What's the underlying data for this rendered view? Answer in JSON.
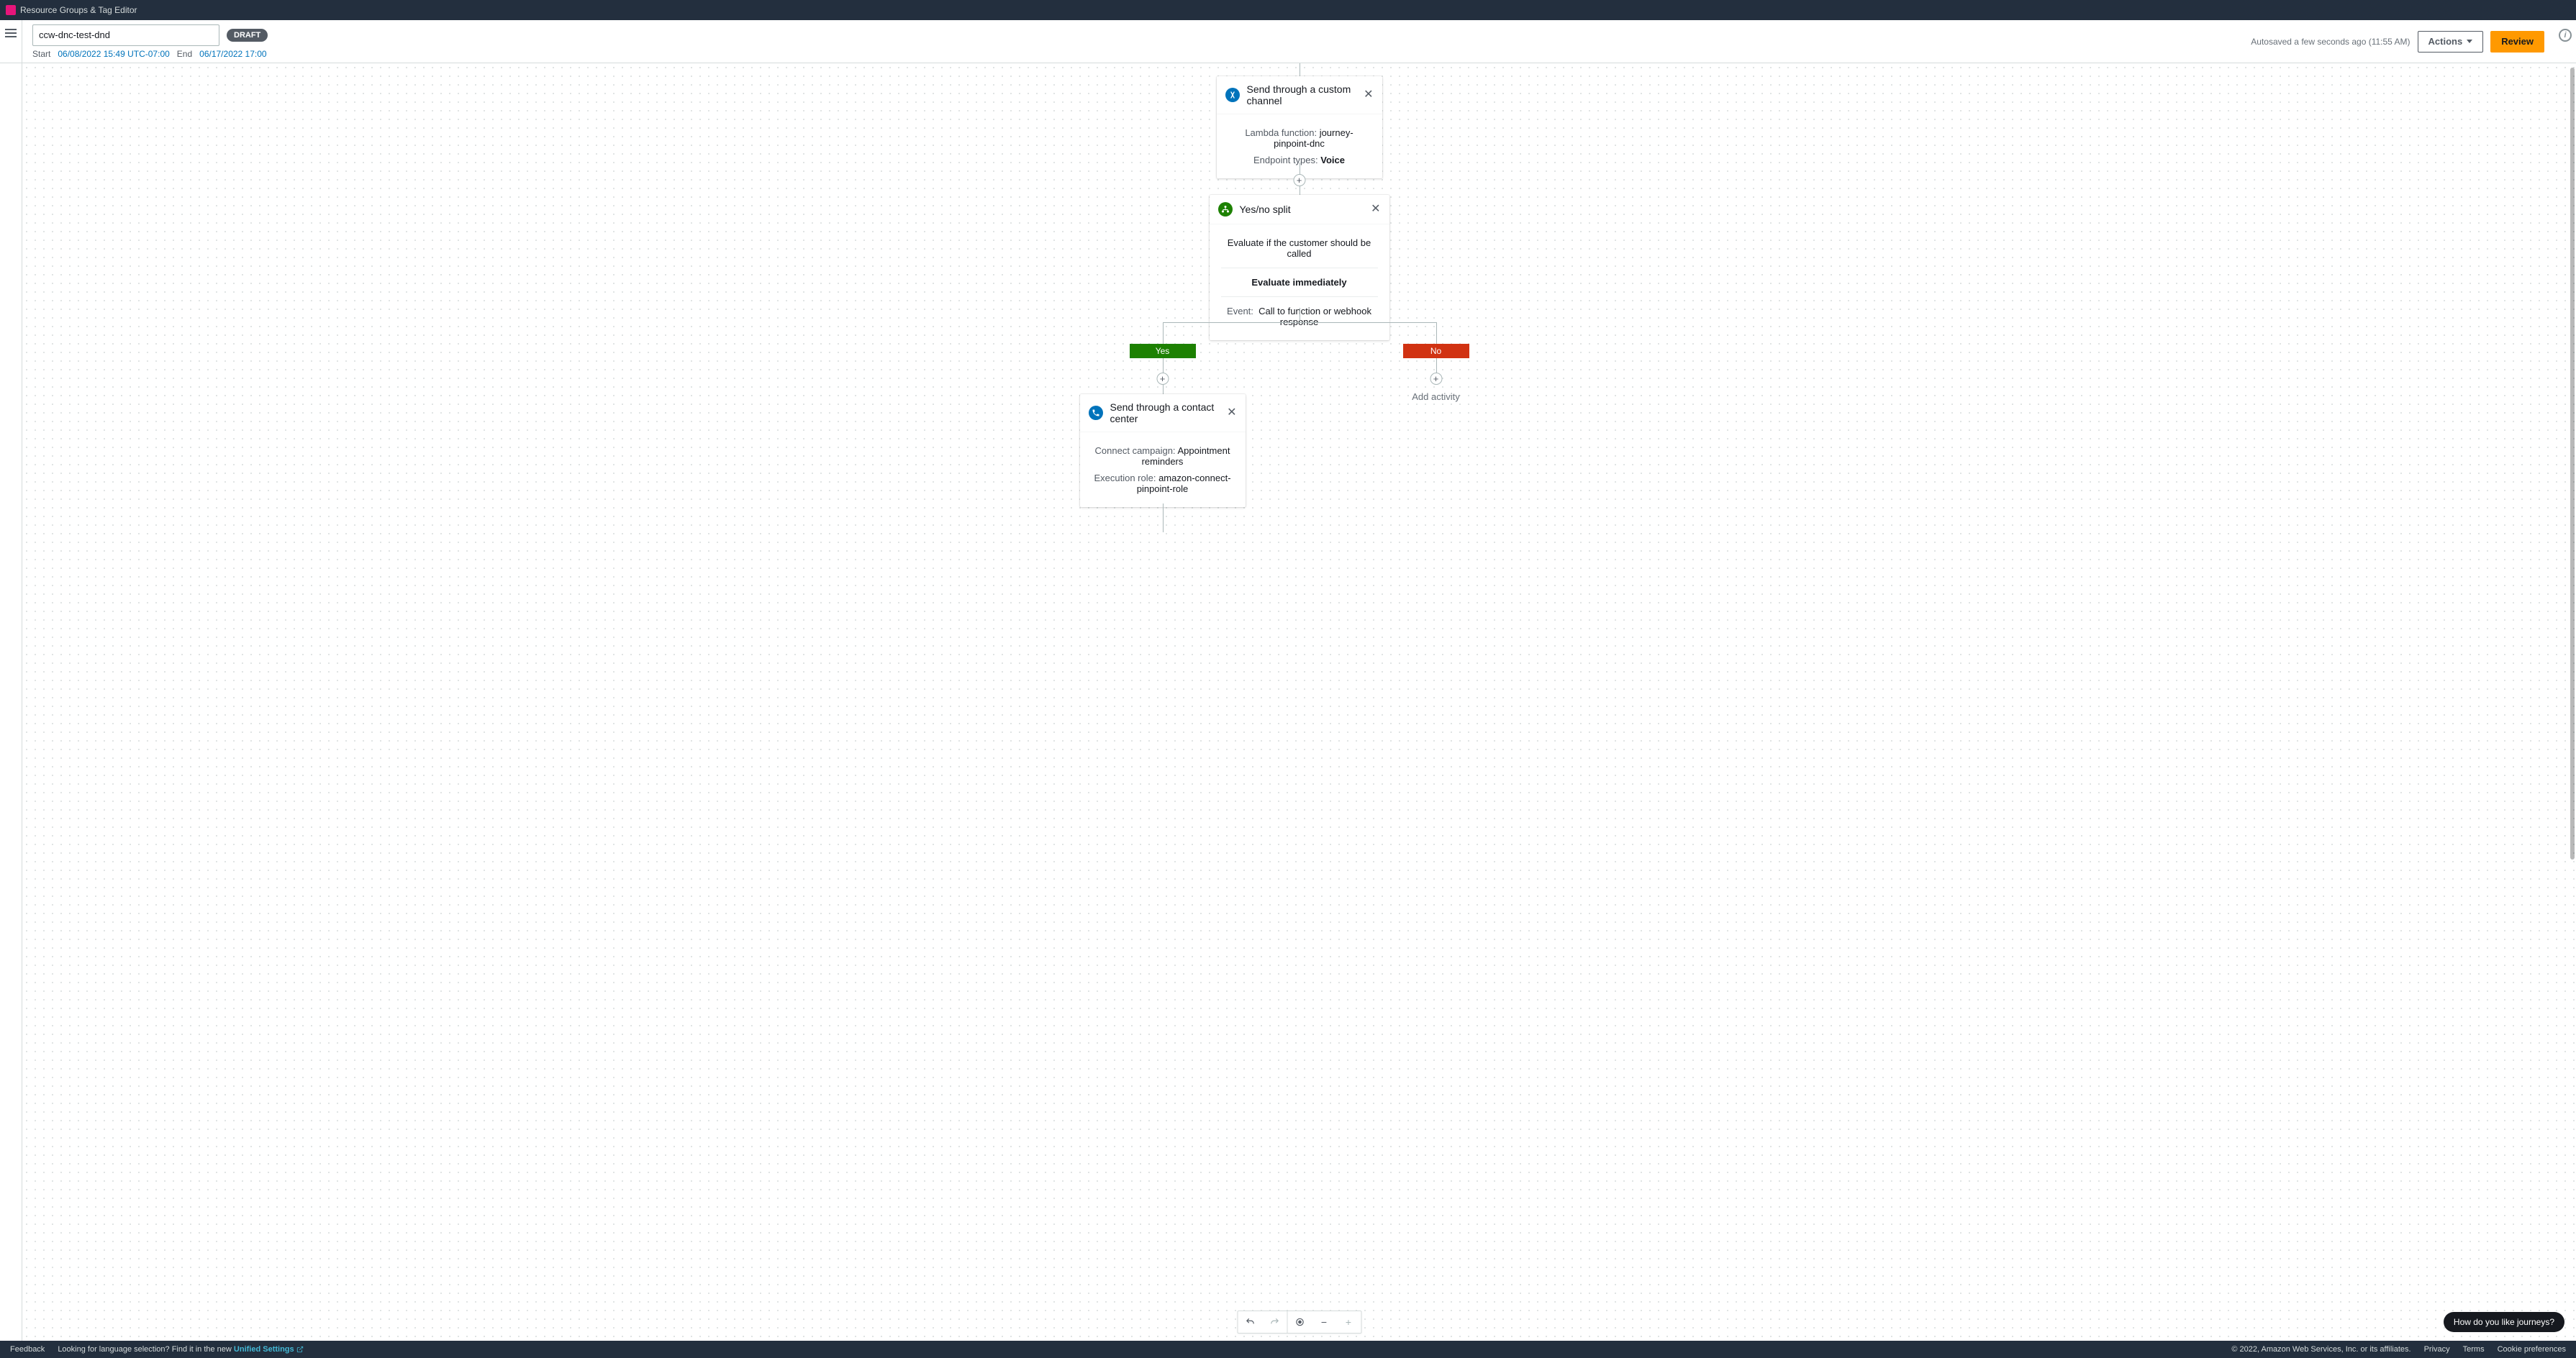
{
  "topbar": {
    "service": "Resource Groups & Tag Editor"
  },
  "header": {
    "journey_name": "ccw-dnc-test-dnd",
    "status_badge": "DRAFT",
    "start_label": "Start",
    "start_value": "06/08/2022 15:49 UTC-07:00",
    "end_label": "End",
    "end_value": "06/17/2022 17:00",
    "autosave": "Autosaved a few seconds ago (11:55 AM)",
    "actions_label": "Actions",
    "review_label": "Review"
  },
  "nodes": {
    "custom_channel": {
      "title": "Send through a custom channel",
      "lambda_label": "Lambda function:",
      "lambda_value": "journey-pinpoint-dnc",
      "endpoint_label": "Endpoint types:",
      "endpoint_value": "Voice"
    },
    "yesno_split": {
      "title": "Yes/no split",
      "desc": "Evaluate if the customer should be called",
      "evaluate": "Evaluate immediately",
      "event_label": "Event:",
      "event_value": "Call to function or webhook response"
    },
    "branches": {
      "yes": "Yes",
      "no": "No",
      "add_activity": "Add activity"
    },
    "contact_center": {
      "title": "Send through a contact center",
      "campaign_label": "Connect campaign:",
      "campaign_value": "Appointment reminders",
      "role_label": "Execution role:",
      "role_value": "amazon-connect-pinpoint-role"
    }
  },
  "feedback_pill": "How do you like journeys?",
  "footer": {
    "feedback": "Feedback",
    "lang_prefix": "Looking for language selection? Find it in the new ",
    "unified": "Unified Settings",
    "copyright": "© 2022, Amazon Web Services, Inc. or its affiliates.",
    "privacy": "Privacy",
    "terms": "Terms",
    "cookie": "Cookie preferences"
  }
}
